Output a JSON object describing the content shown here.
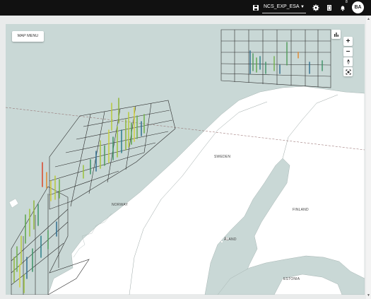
{
  "topbar": {
    "project_name": "NCS_EXP_ESA",
    "notification_count": "8",
    "user_initials": "BA",
    "icons": [
      "save-icon",
      "settings-icon",
      "book-icon",
      "bell-icon"
    ]
  },
  "map": {
    "menu_label": "MAP MENU",
    "controls": {
      "zoom_in": "+",
      "zoom_out": "−"
    },
    "labels": {
      "sweden": "SWEDEN",
      "norway": "NORWAY",
      "finland": "FINLAND",
      "aland": "ÅLAND",
      "estonia": "ESTONIA"
    }
  },
  "colors": {
    "sea": "#c9d8d6",
    "land": "#ffffff",
    "topbar": "#111111",
    "grid_line": "#2b2b2b"
  }
}
